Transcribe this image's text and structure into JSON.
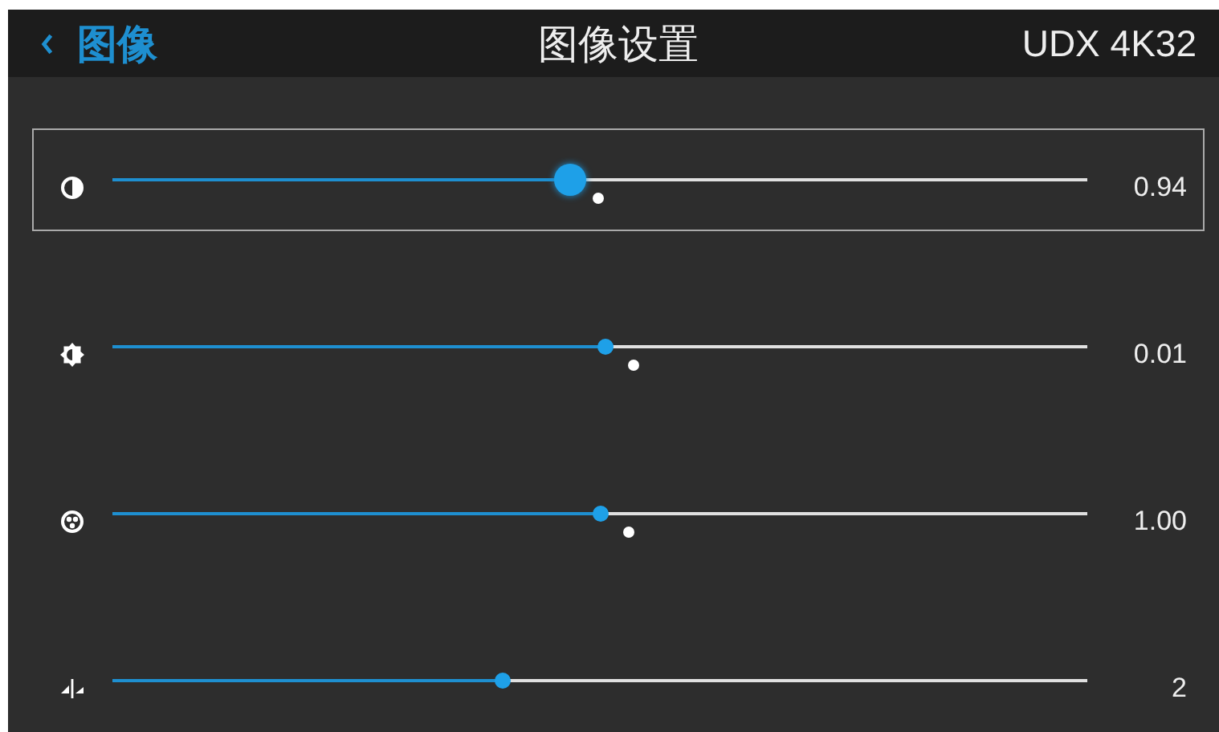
{
  "header": {
    "back_label": "图像",
    "title": "图像设置",
    "device": "UDX 4K32"
  },
  "sliders": [
    {
      "kind": "contrast",
      "selected": true,
      "level": 0.47,
      "default_marker": true,
      "reading": "0.94"
    },
    {
      "kind": "brightness",
      "selected": false,
      "level": 0.505,
      "default_marker": true,
      "reading": "0.01"
    },
    {
      "kind": "saturation",
      "selected": false,
      "level": 0.5,
      "default_marker": true,
      "reading": "1.00"
    },
    {
      "kind": "sharpness",
      "selected": false,
      "level": 0.4,
      "default_marker": false,
      "reading": "2"
    }
  ]
}
